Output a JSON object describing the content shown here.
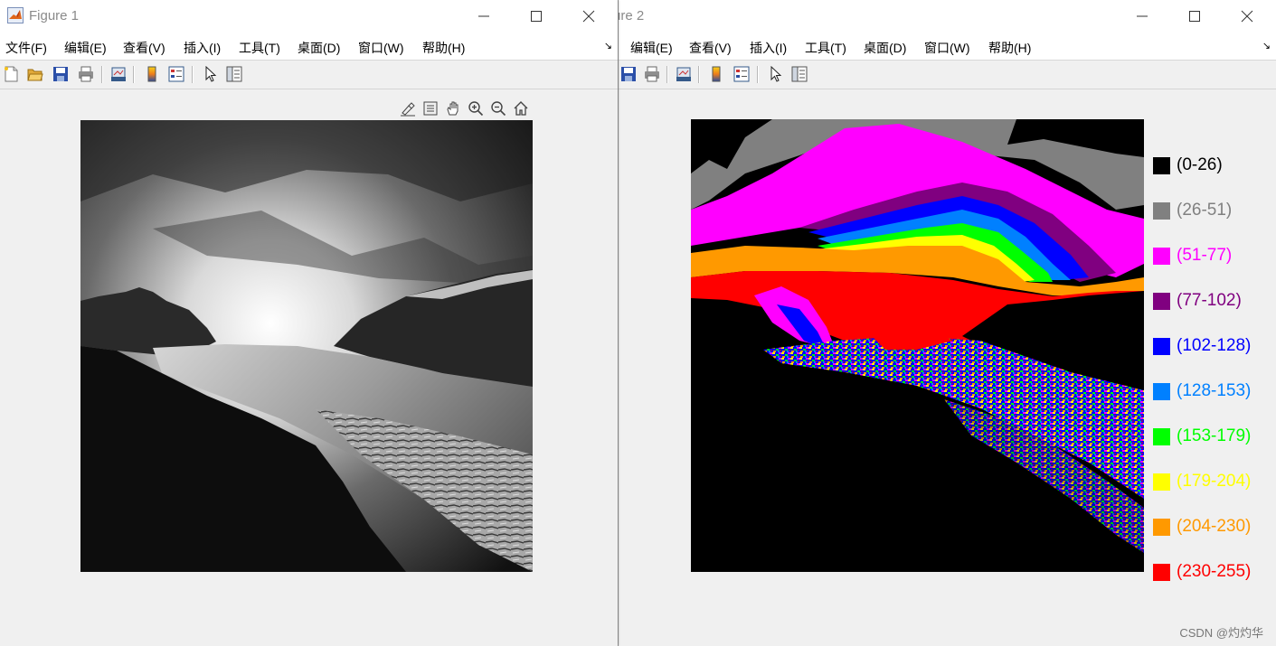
{
  "figure1": {
    "title": "Figure 1",
    "menu": [
      "文件(F)",
      "编辑(E)",
      "查看(V)",
      "插入(I)",
      "工具(T)",
      "桌面(D)",
      "窗口(W)",
      "帮助(H)"
    ],
    "image_description_note": ""
  },
  "figure2": {
    "title": "ure 2",
    "menu": [
      "编辑(E)",
      "查看(V)",
      "插入(I)",
      "工具(T)",
      "桌面(D)",
      "窗口(W)",
      "帮助(H)"
    ],
    "legend": [
      {
        "label": "(0-26)",
        "color": "#000000"
      },
      {
        "label": "(26-51)",
        "color": "#808080"
      },
      {
        "label": "(51-77)",
        "color": "#ff00ff"
      },
      {
        "label": "(77-102)",
        "color": "#800080"
      },
      {
        "label": "(102-128)",
        "color": "#0000ff"
      },
      {
        "label": "(128-153)",
        "color": "#0080ff"
      },
      {
        "label": "(153-179)",
        "color": "#00ff00"
      },
      {
        "label": "(179-204)",
        "color": "#ffff00"
      },
      {
        "label": "(204-230)",
        "color": "#ff9900"
      },
      {
        "label": "(230-255)",
        "color": "#ff0000"
      }
    ]
  },
  "watermark": "CSDN @灼灼华"
}
